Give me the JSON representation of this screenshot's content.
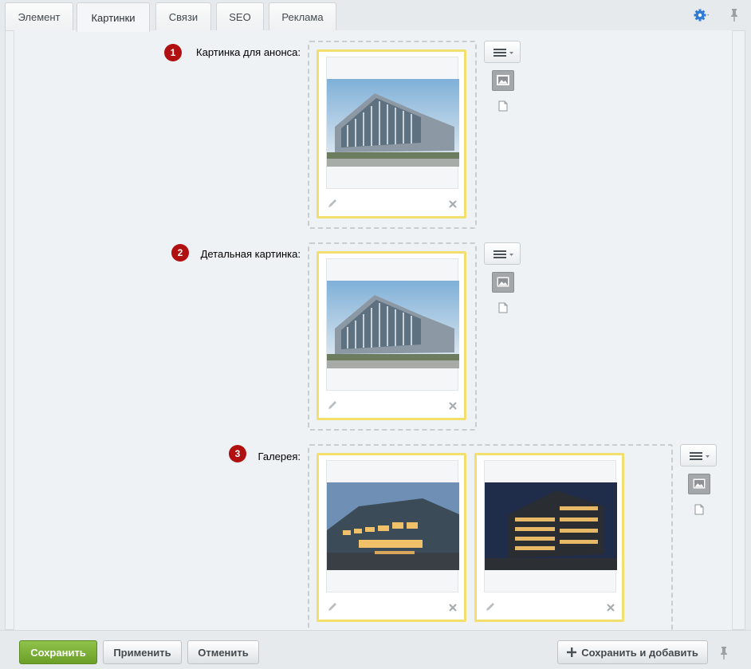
{
  "tabs": [
    {
      "label": "Элемент"
    },
    {
      "label": "Картинки"
    },
    {
      "label": "Связи"
    },
    {
      "label": "SEO"
    },
    {
      "label": "Реклама"
    }
  ],
  "active_tab": "Картинки",
  "fields": [
    {
      "marker": "1",
      "label": "Картинка для анонса:"
    },
    {
      "marker": "2",
      "label": "Детальная картинка:"
    },
    {
      "marker": "3",
      "label": "Галерея:"
    }
  ],
  "footer": {
    "save": "Сохранить",
    "apply": "Применить",
    "cancel": "Отменить",
    "save_add": "Сохранить и добавить"
  },
  "icons": {
    "settings": "gear-icon",
    "pin": "pin-icon",
    "menu": "menu-icon",
    "image": "image-icon",
    "file": "file-icon",
    "edit": "pencil-icon",
    "delete": "close-icon",
    "add": "plus-icon"
  },
  "colors": {
    "accent_gear": "#2f7bd6",
    "marker": "#b11010",
    "card_border": "#f3df6e",
    "save_button": "#7cb13a"
  }
}
